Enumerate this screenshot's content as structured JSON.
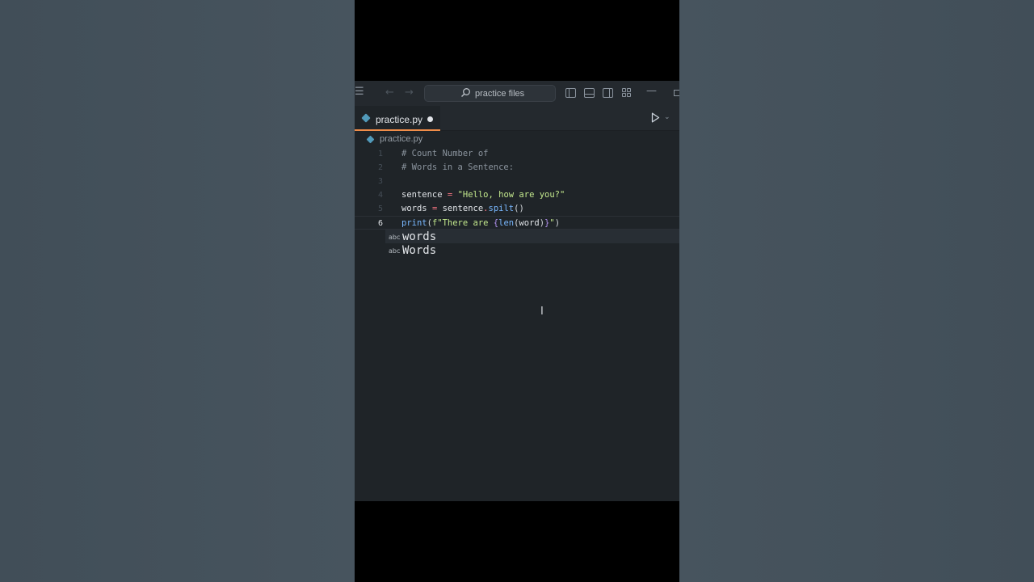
{
  "titlebar": {
    "search_placeholder": "practice files",
    "icons": [
      "menu-icon",
      "back-arrow-icon",
      "forward-arrow-icon",
      "search-icon",
      "toggle-primary-sidebar-icon",
      "toggle-panel-icon",
      "toggle-secondary-sidebar-icon",
      "customize-layout-icon",
      "minimize-icon",
      "maximize-icon"
    ]
  },
  "tabs": [
    {
      "label": "practice.py",
      "dirty": true,
      "active": true
    }
  ],
  "breadcrumb": {
    "file": "practice.py"
  },
  "editor": {
    "current_line": 6,
    "line_numbers": [
      "1",
      "2",
      "3",
      "4",
      "5",
      "6"
    ],
    "lines": [
      "# Count Number of",
      "# Words in a Sentence:",
      "",
      "sentence = \"Hello, how are you?\"",
      "words = sentence.spilt()",
      "print(f\"There are {len(word)}\")"
    ]
  },
  "autocomplete": {
    "kind_label": "abc",
    "items": [
      "words",
      "Words"
    ]
  },
  "colors": {
    "editor_bg": "#1f2428",
    "titlebar_bg": "#24292e",
    "tab_accent": "#f08d49",
    "comment": "#8b949e",
    "string": "#c3e88d",
    "function": "#79b8ff",
    "operator": "#f97583",
    "brace": "#b392f0",
    "python_icon": "#519aba"
  }
}
